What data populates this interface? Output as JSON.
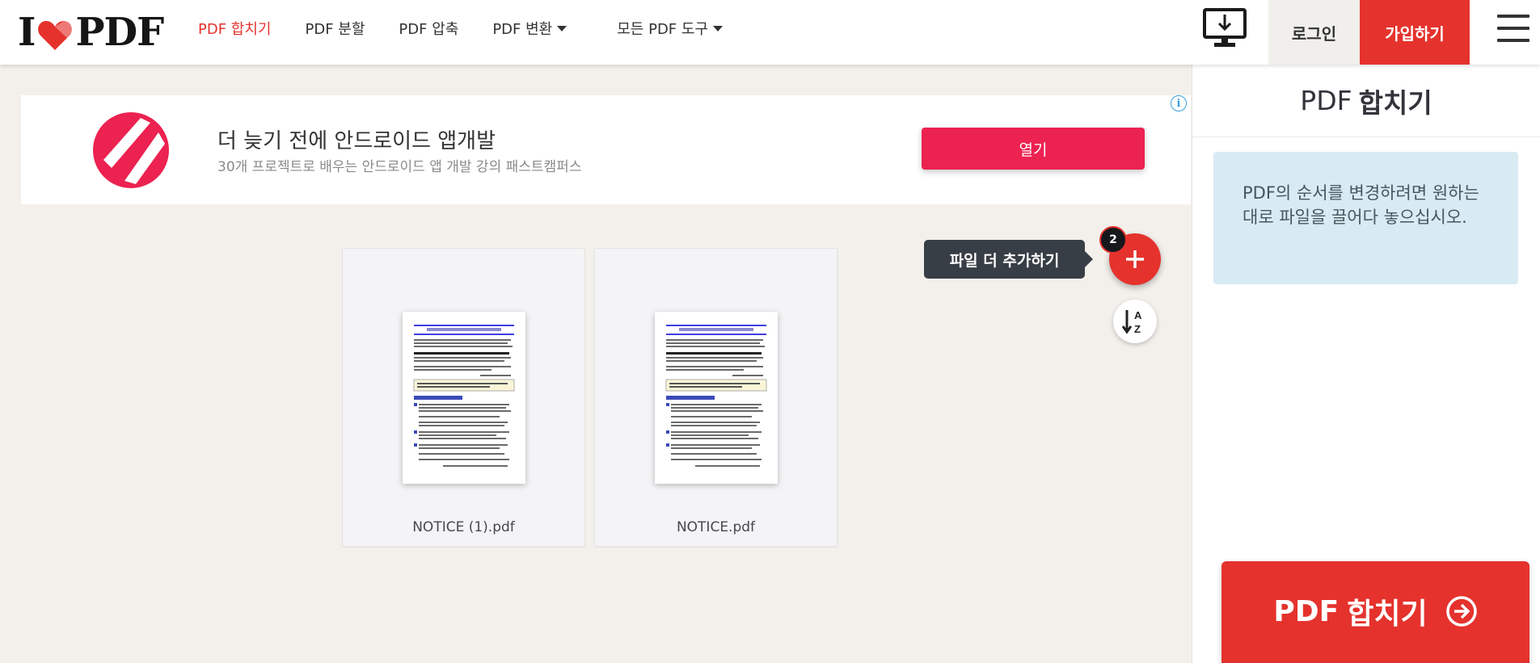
{
  "header": {
    "logo_left": "I",
    "logo_right": "PDF",
    "nav": [
      {
        "label": "PDF 합치기",
        "active": true
      },
      {
        "label": "PDF 분할"
      },
      {
        "label": "PDF 압축"
      },
      {
        "label": "PDF 변환",
        "dropdown": true
      },
      {
        "label": "모든 PDF 도구",
        "dropdown": true
      }
    ],
    "login_label": "로그인",
    "signup_label": "가입하기",
    "icons": {
      "desktop": "desktop-download-icon",
      "menu": "hamburger-menu-icon"
    }
  },
  "ad": {
    "title": "더 늦기 전에 안드로이드 앱개발",
    "subtitle": "30개 프로젝트로 배우는 안드로이드 앱 개발 강의 패스트캠퍼스",
    "button_label": "열기",
    "info_glyph": "i",
    "accent_color": "#ec2251"
  },
  "files": [
    {
      "name": "NOTICE (1).pdf"
    },
    {
      "name": "NOTICE.pdf"
    }
  ],
  "toolbar": {
    "add_more_label": "파일 더 추가하기",
    "file_count": "2",
    "icons": {
      "add": "plus-icon",
      "sort": "sort-alpha-icon"
    }
  },
  "sidebar": {
    "title_prefix": "PDF",
    "title_main": "합치기",
    "info_text": "PDF의 순서를 변경하려면 원하는 대로 파일을 끌어다 놓으십시오.",
    "merge_prefix": "PDF",
    "merge_main": "합치기",
    "icons": {
      "merge": "arrow-circle-right-icon"
    }
  },
  "colors": {
    "brand": "#e5322d",
    "info_bg": "#d8ebf3",
    "canvas_bg": "#f3f0ec"
  }
}
